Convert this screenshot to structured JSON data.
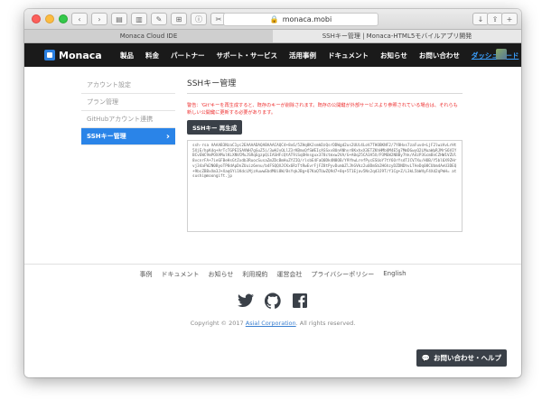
{
  "browser": {
    "address": "monaca.mobi",
    "tabs": [
      "Monaca Cloud IDE",
      "SSHキー管理 | Monaca-HTML5モバイルアプリ開発"
    ]
  },
  "nav": {
    "logo": "Monaca",
    "items": [
      "製品",
      "料金",
      "パートナー",
      "サポート・サービス",
      "活用事例",
      "ドキュメント",
      "お知らせ",
      "お問い合わせ",
      "ダッシュボード"
    ]
  },
  "sidebar": {
    "items": [
      {
        "label": "アカウント設定"
      },
      {
        "label": "プラン管理"
      },
      {
        "label": "GitHubアカウント連携"
      },
      {
        "label": "SSHキー管理"
      }
    ]
  },
  "main": {
    "title": "SSHキー管理",
    "warning": "警告：'Git'キーを再生成すると、既存のキーが削除されます。既存の公開鍵が外部サービスより参照されている場合は、それらも新しい公開鍵に更新する必要があります。",
    "regen_button": "SSHキー 再生成",
    "key": "ssh-rsa AAAAB3NzaC1yc2EAAAADAQABAAACAQC4+8x6/5ZHq8KJsmkDzQsrDDWgd2us2UUi4LoV7THOBKNF2/7Y8Hxs7zaFuvd+LjF2lwzAvLrHt5XjE/hpK4q+ArTcTGPEISAVWH7gGuZ5i/3wHJvQLlZ3rKBmxQfSWEIcASSxv8UnANhvr8KxhxX3ETZKhHMbUM4E5g7MmDGwyQ2LMuaWpRJMrS6VIYBCvEWC9mPOXAMulKLXNVCMuJSRqEgzpQiIASHFcQtAT9iSqOHnsgux378ctmxw2VA/G+A0q25CA3A5X/P3MEW2NBBy7hk/A4zP3GcmBnCZHW1VZUl8vcnrFA+7ieGFBeHsGtZxdb3RuocSusaZmZDcBmHuZYZIQ/rlsbE4FaQ0Dk4N8OB/Y9YhwLrefPycESUoY7tY6OrYsdTJCV7Xu/HOB/Y5bl6X9ZHrvj34aFW2N0ByoTP8dApDnZUuiz6enu/b4FSQQXJCKx6RzTtRwEvrFjFZ8tPyvDumbZlJhGVkz2u0DmSb2H6hzyDZDNDhvLTAeDq08CUbm4AeU3DEQ+9bcZBBxXm3J+Xaq6Yi1KdcLMjzAuwwEbdMUi8W/BsYqkJBg+Q7KaQTUwZQ9d7+8q+5T1Ejav5Ns2qd3J9T/f1Cg+Z/L3kL5bW4yF4Xd2qPmH= atsushi@moongift.jp"
  },
  "footer": {
    "links": [
      "事例",
      "ドキュメント",
      "お知らせ",
      "利用規約",
      "運営会社",
      "プライバシーポリシー",
      "English"
    ],
    "copyright_prefix": "Copyright © 2017 ",
    "copyright_link": "Asial Corporation",
    "copyright_suffix": ". All rights reserved."
  },
  "help_button": "お問い合わせ・ヘルプ",
  "colors": {
    "accent": "#2a84e8",
    "nav_bg": "#1a1a1a",
    "warning": "#ee3333"
  }
}
